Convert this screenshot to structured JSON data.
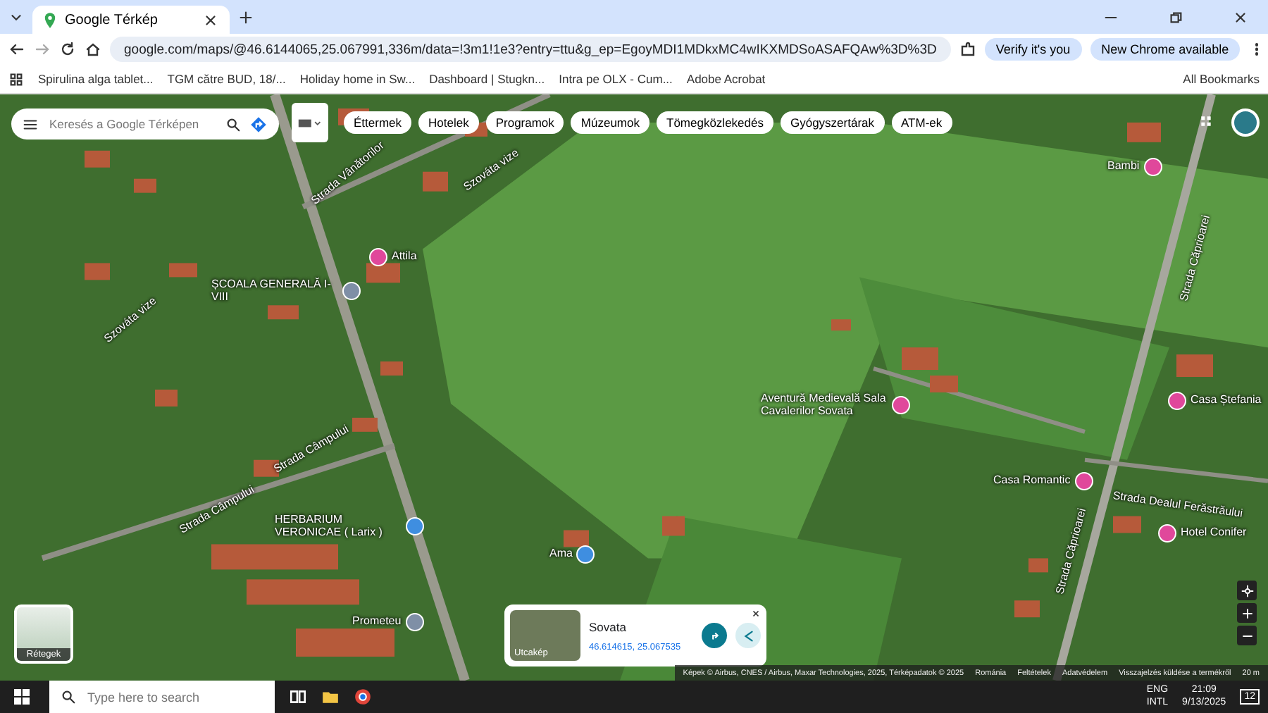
{
  "browser": {
    "tabs": [
      {
        "title": "Google Térkép",
        "selected": true
      }
    ],
    "url": "google.com/maps/@46.6144065,25.067991,336m/data=!3m1!1e3?entry=ttu&g_ep=EgoyMDI1MDkxMC4wIKXMDSoASAFQAw%3D%3D",
    "verify_button": "Verify it's you",
    "update_button": "New Chrome available",
    "bookmarks": [
      "Spirulina alga tablet...",
      "TGM către BUD, 18/...",
      "Holiday home in Sw...",
      "Dashboard | Stugkn...",
      "Intra pe OLX - Cum...",
      "Adobe Acrobat"
    ],
    "all_bookmarks": "All Bookmarks"
  },
  "map": {
    "search_placeholder": "Keresés a Google Térképen",
    "categories": [
      "Éttermek",
      "Hotelek",
      "Programok",
      "Múzeumok",
      "Tömegközlekedés",
      "Gyógyszertárak",
      "ATM-ek"
    ],
    "labels": [
      {
        "text": "Strada Vânătorilor",
        "kind": "street"
      },
      {
        "text": "Szováta vize",
        "kind": "street"
      },
      {
        "text": "Attila",
        "kind": "poi",
        "color": "#e0489b"
      },
      {
        "text": "ȘCOALA GENERALĂ I-VIII",
        "kind": "poi",
        "color": "#7f8fa6"
      },
      {
        "text": "Szováta vize",
        "kind": "street"
      },
      {
        "text": "Strada Câmpului",
        "kind": "street"
      },
      {
        "text": "Strada Câmpului",
        "kind": "street"
      },
      {
        "text": "HERBARIUM VERONICAE ( Larix )",
        "kind": "poi",
        "color": "#3f8ee0"
      },
      {
        "text": "Ama",
        "kind": "poi",
        "color": "#3f8ee0"
      },
      {
        "text": "Prometeu",
        "kind": "poi",
        "color": "#7f8fa6"
      },
      {
        "text": "Bambi",
        "kind": "poi",
        "color": "#e0489b"
      },
      {
        "text": "Strada Căprioarei",
        "kind": "street"
      },
      {
        "text": "Aventură Medievală Sala Cavalerilor Sovata",
        "kind": "poi",
        "color": "#e0489b"
      },
      {
        "text": "Casa Ștefania",
        "kind": "poi",
        "color": "#e0489b"
      },
      {
        "text": "Casa Romantic",
        "kind": "poi",
        "color": "#e0489b"
      },
      {
        "text": "Strada Dealul Ferăstrăului",
        "kind": "street"
      },
      {
        "text": "Hotel Conifer",
        "kind": "poi",
        "color": "#e0489b"
      },
      {
        "text": "Strada Căprioarei",
        "kind": "street"
      }
    ],
    "layers_label": "Rétegek",
    "place_card": {
      "name": "Sovata",
      "coordinates": "46.614615, 25.067535",
      "street_view_label": "Utcakép"
    },
    "attribution": "Képek © Airbus, CNES / Airbus, Maxar Technologies, 2025, Térképadatok © 2025",
    "footer_links": [
      "Románia",
      "Feltételek",
      "Adatvédelem",
      "Visszajelzés küldése a termékről"
    ],
    "scale": "20 m"
  },
  "taskbar": {
    "search_placeholder": "Type here to search",
    "language": "ENG",
    "layout": "INTL",
    "time": "21:09",
    "date": "9/13/2025",
    "notifications": "12"
  }
}
